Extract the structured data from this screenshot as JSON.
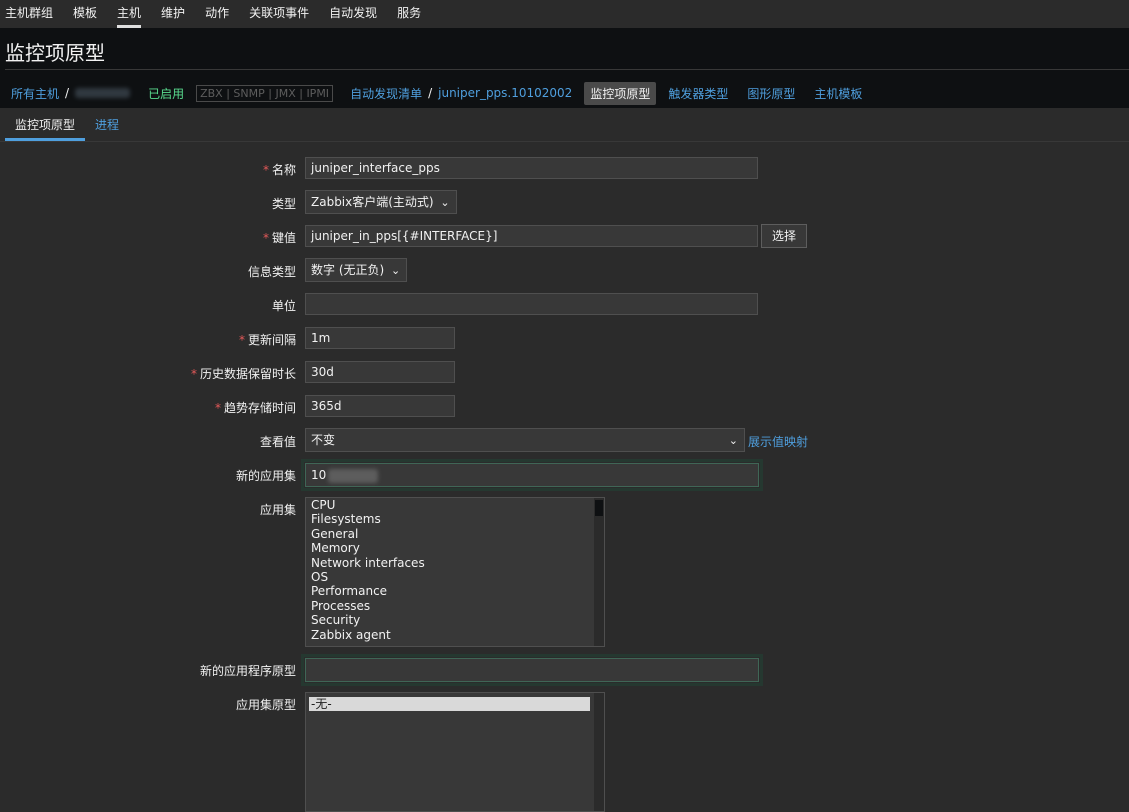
{
  "top_menu": [
    "主机群组",
    "模板",
    "主机",
    "维护",
    "动作",
    "关联项事件",
    "自动发现",
    "服务"
  ],
  "top_menu_active": 2,
  "page_title": "监控项原型",
  "breadcrumb": {
    "all_hosts": "所有主机",
    "enabled": "已启用",
    "availability": [
      "ZBX",
      "SNMP",
      "JMX",
      "IPMI"
    ],
    "discovery_list": "自动发现清单",
    "discovery_rule": "juniper_pps.10102002",
    "item_prototypes": "监控项原型",
    "trigger_types": "触发器类型",
    "graph_prototypes": "图形原型",
    "host_templates": "主机模板"
  },
  "tabs": [
    {
      "label": "监控项原型",
      "active": true
    },
    {
      "label": "进程",
      "active": false
    }
  ],
  "form": {
    "name_label": "名称",
    "name_value": "juniper_interface_pps",
    "type_label": "类型",
    "type_value": "Zabbix客户端(主动式)",
    "key_label": "键值",
    "key_value": "juniper_in_pps[{#INTERFACE}]",
    "key_button": "选择",
    "info_type_label": "信息类型",
    "info_type_value": "数字 (无正负)",
    "units_label": "单位",
    "units_value": "",
    "interval_label": "更新间隔",
    "interval_value": "1m",
    "history_label": "历史数据保留时长",
    "history_value": "30d",
    "trends_label": "趋势存储时间",
    "trends_value": "365d",
    "valuemap_label": "查看值",
    "valuemap_value": "不变",
    "valuemap_link": "展示值映射",
    "new_app_label": "新的应用集",
    "new_app_value": "10",
    "apps_label": "应用集",
    "apps": [
      "CPU",
      "Filesystems",
      "General",
      "Memory",
      "Network interfaces",
      "OS",
      "Performance",
      "Processes",
      "Security",
      "Zabbix agent"
    ],
    "new_app_proto_label": "新的应用程序原型",
    "new_app_proto_value": "",
    "app_proto_label": "应用集原型",
    "app_protos": [
      "-无-"
    ]
  }
}
